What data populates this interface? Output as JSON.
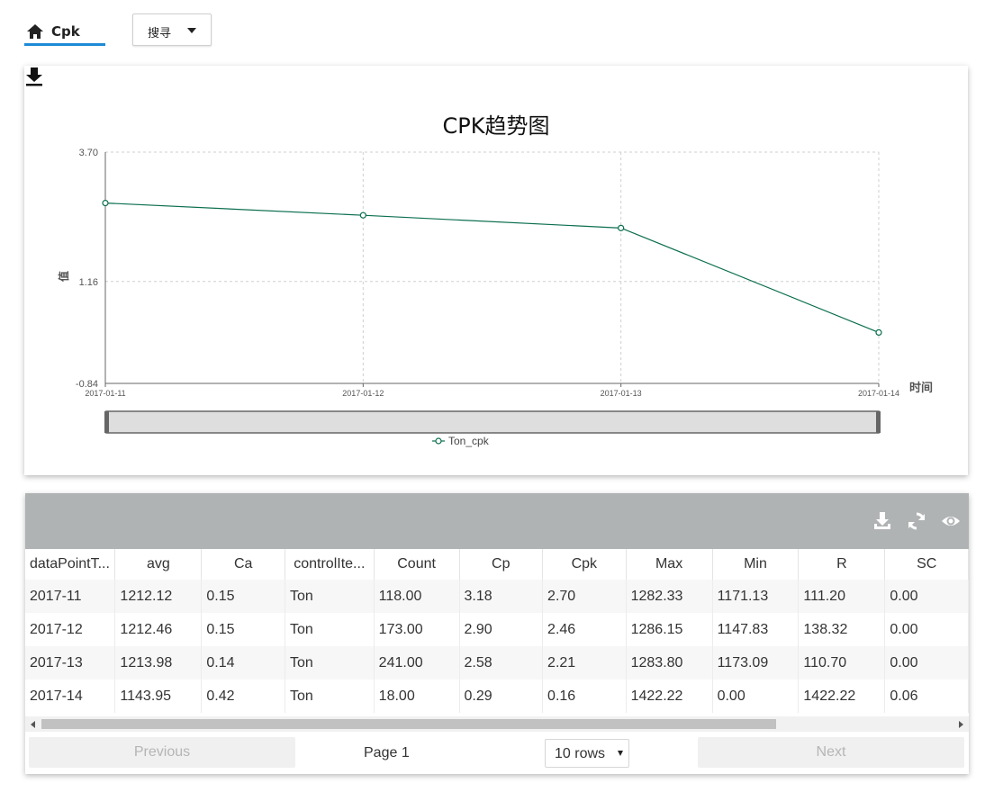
{
  "tab": {
    "label": "Cpk",
    "icon": "home-icon"
  },
  "search": {
    "label": "搜寻",
    "icon": "caret-down-icon"
  },
  "chart_data": {
    "type": "line",
    "title": "CPK趋势图",
    "xlabel": "时间",
    "ylabel": "值",
    "categories": [
      "2017-01-11",
      "2017-01-12",
      "2017-01-13",
      "2017-01-14"
    ],
    "series": [
      {
        "name": "Ton_cpk",
        "values": [
          2.7,
          2.46,
          2.21,
          0.16
        ],
        "color": "#0b6e4f"
      }
    ],
    "ylim": [
      -0.84,
      3.7
    ],
    "yticks": [
      "3.70",
      "1.16",
      "-0.84"
    ],
    "grid": true,
    "legend": "bottom-center",
    "data_zoom": true
  },
  "table": {
    "toolbar_icons": [
      "download-icon",
      "refresh-icon",
      "eye-icon"
    ],
    "columns": [
      "dataPointT...",
      "avg",
      "Ca",
      "controlIte...",
      "Count",
      "Cp",
      "Cpk",
      "Max",
      "Min",
      "R",
      "SC"
    ],
    "rows": [
      [
        "2017-11",
        "1212.12",
        "0.15",
        "Ton",
        "118.00",
        "3.18",
        "2.70",
        "1282.33",
        "1171.13",
        "111.20",
        "0.00"
      ],
      [
        "2017-12",
        "1212.46",
        "0.15",
        "Ton",
        "173.00",
        "2.90",
        "2.46",
        "1286.15",
        "1147.83",
        "138.32",
        "0.00"
      ],
      [
        "2017-13",
        "1213.98",
        "0.14",
        "Ton",
        "241.00",
        "2.58",
        "2.21",
        "1283.80",
        "1173.09",
        "110.70",
        "0.00"
      ],
      [
        "2017-14",
        "1143.95",
        "0.42",
        "Ton",
        "18.00",
        "0.29",
        "0.16",
        "1422.22",
        "0.00",
        "1422.22",
        "0.06"
      ]
    ]
  },
  "pager": {
    "previous": "Previous",
    "page": "Page 1",
    "rows": "10 rows",
    "next": "Next"
  },
  "colors": {
    "accent": "#1d8ad6",
    "toolbar": "#b0b3b4",
    "series": "#0b6e4f"
  }
}
